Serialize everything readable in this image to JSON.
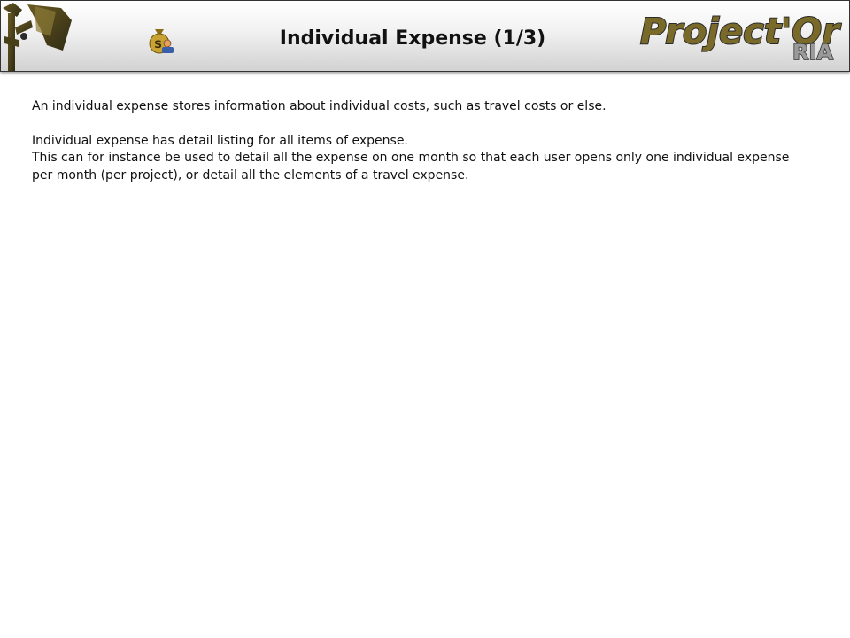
{
  "header": {
    "title": "Individual Expense (1/3)",
    "logo_text": "Project'Or",
    "logo_subtext": "RIA",
    "left_logo_icon": "projector-icon",
    "page_icon": "money-bag-icon",
    "colors": {
      "logo_fill": "#7a6a2a",
      "logo_outline": "#2b2b2b"
    }
  },
  "content": {
    "paragraph_1": "An individual expense stores information about individual costs, such as travel costs or else.",
    "paragraph_2_line_1": "Individual expense has detail listing for all items of expense.",
    "paragraph_2_line_2": "This can for instance be used to detail all the expense on one month so that each user opens only one individual expense per month (per project), or detail all the elements of a travel expense."
  }
}
